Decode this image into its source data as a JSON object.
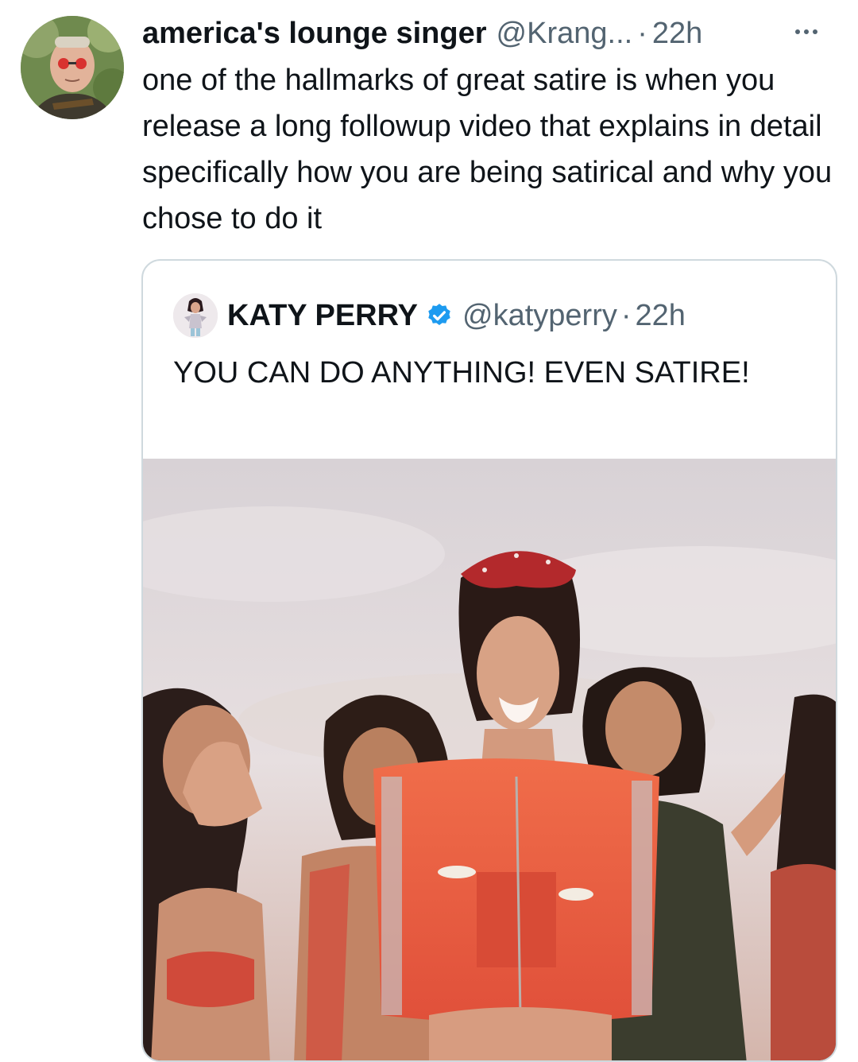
{
  "tweet": {
    "display_name": "america's lounge singer",
    "handle": "@Krang...",
    "separator": "·",
    "time": "22h",
    "text": "one of the hallmarks of great satire is when you release a long followup video that explains in detail specifically how you are being satirical and why you chose to do it",
    "avatar_icon": "user-avatar-photo",
    "more_icon": "more-options-icon"
  },
  "quote": {
    "display_name": "KATY PERRY",
    "verified_icon": "verified-badge-icon",
    "verified_color": "#1d9bf0",
    "handle": "@katyperry",
    "separator": "·",
    "time": "22h",
    "text": "YOU CAN DO ANYTHING! EVEN SATIRE!",
    "media_icon": "video-thumbnail-image"
  },
  "colors": {
    "text_primary": "#0f1419",
    "text_secondary": "#536471",
    "border": "#cfd9de"
  }
}
